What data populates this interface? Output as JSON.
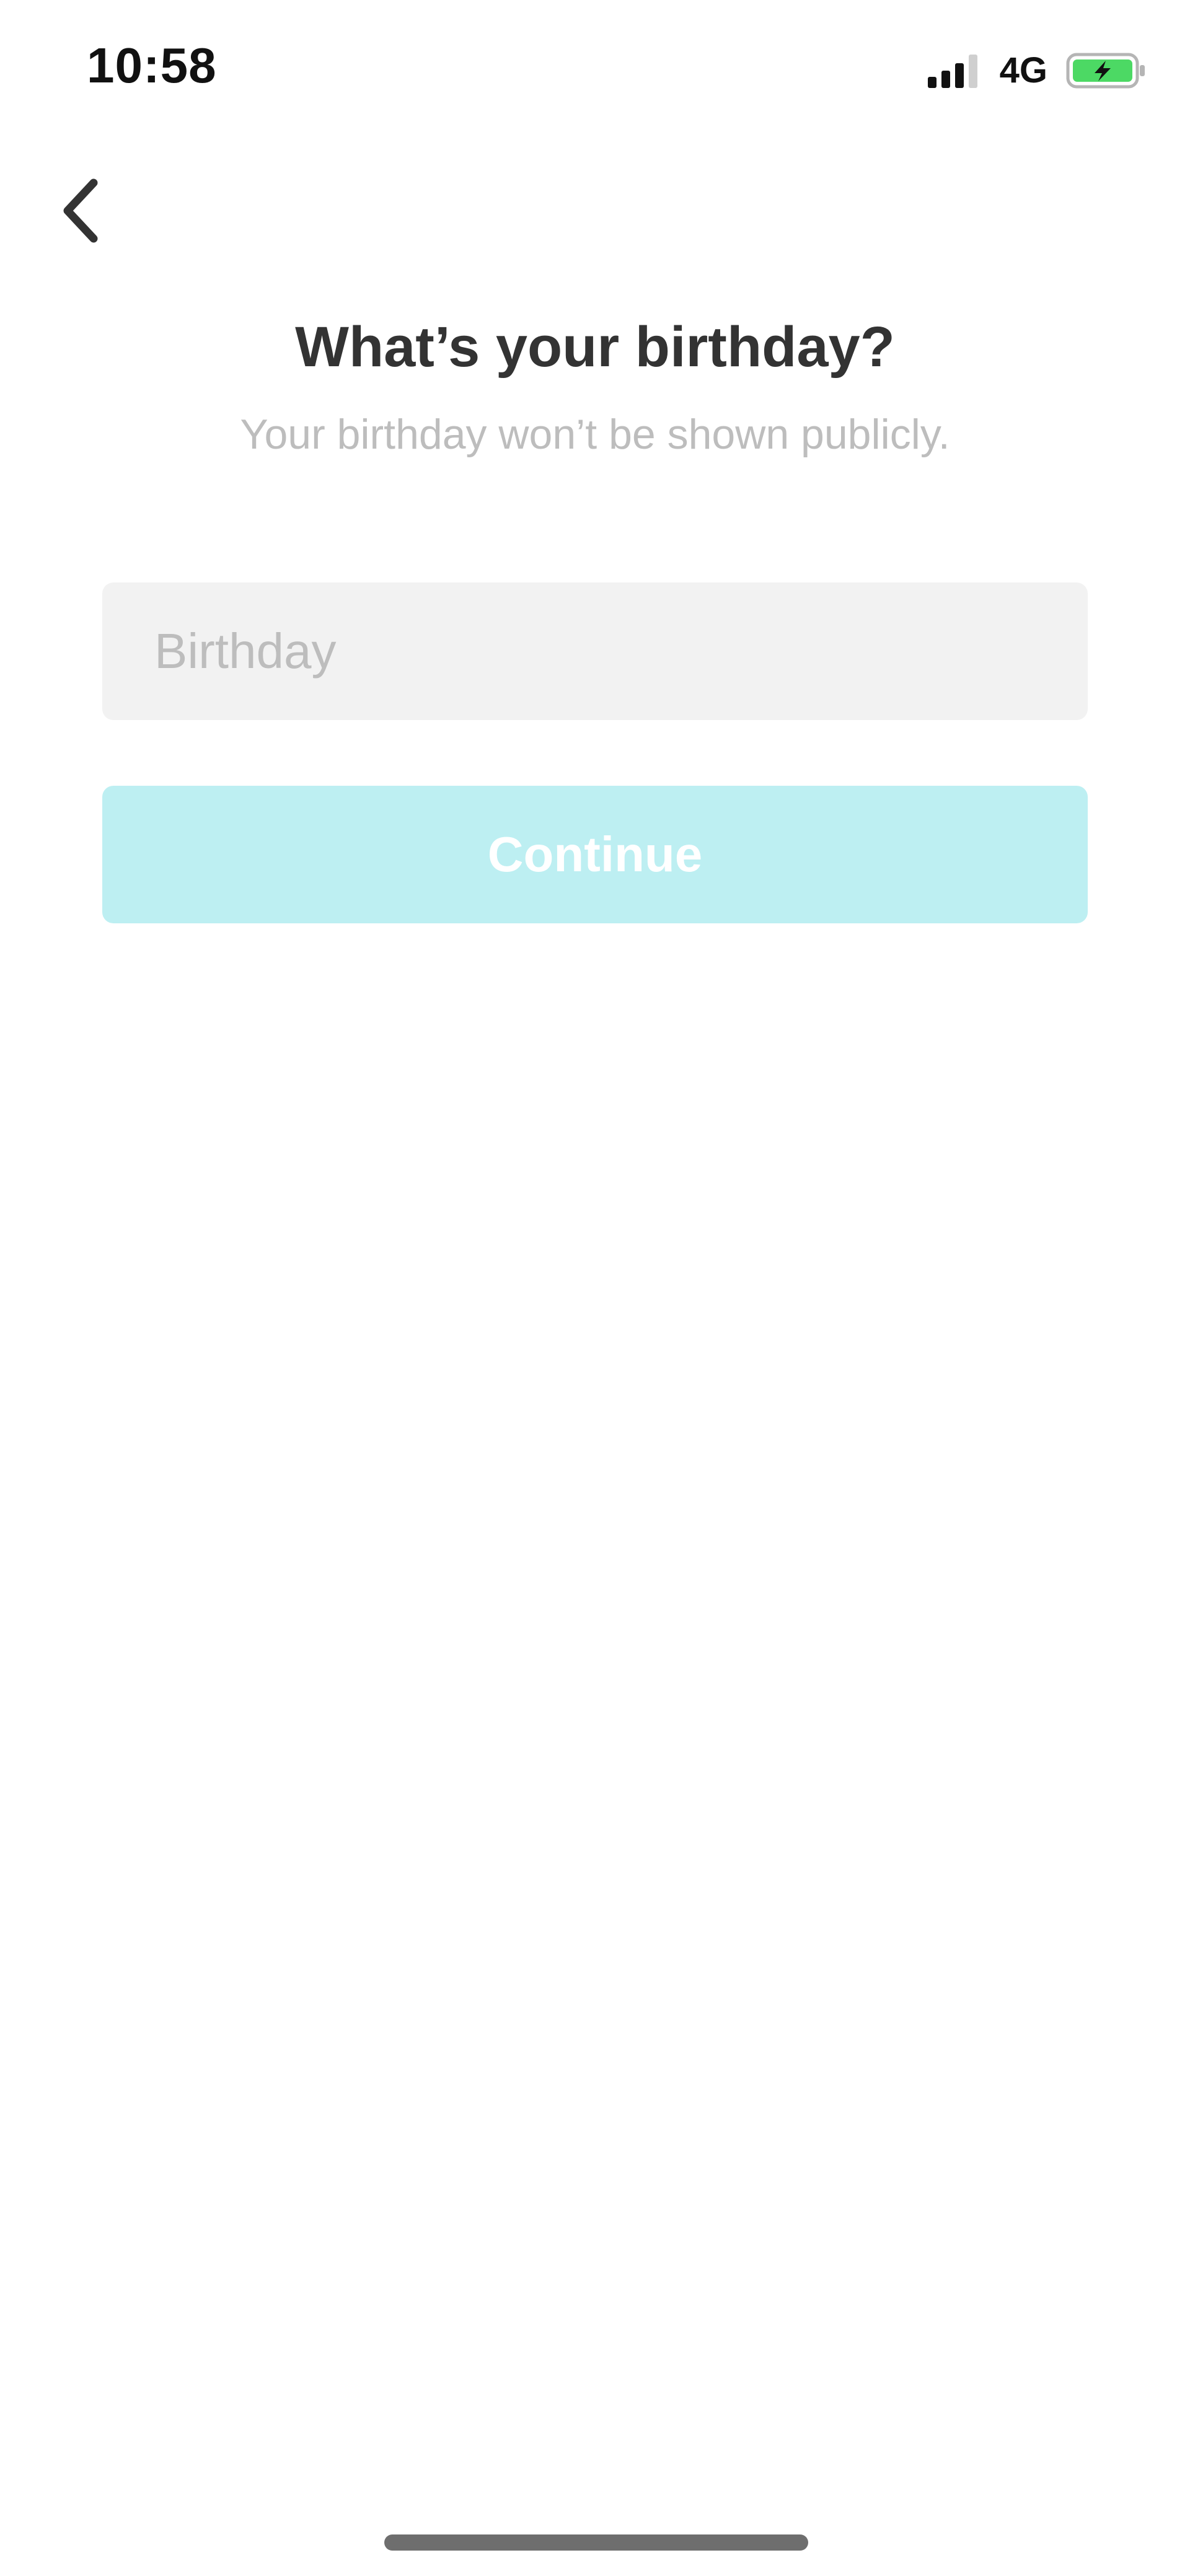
{
  "status_bar": {
    "time": "10:58",
    "network": "4G",
    "signal_icon": "signal-bars-icon",
    "battery_icon": "battery-charging-icon",
    "battery_color": "#4cd964"
  },
  "nav": {
    "back_icon": "chevron-left-icon"
  },
  "header": {
    "title": "What’s your birthday?",
    "subtitle": "Your birthday won’t be shown publicly."
  },
  "form": {
    "birthday": {
      "value": "",
      "placeholder": "Birthday"
    },
    "continue_label": "Continue"
  },
  "colors": {
    "accent_disabled": "#bdeff2",
    "title": "#333333",
    "muted": "#bdbdbd",
    "input_bg": "#f2f2f2"
  }
}
